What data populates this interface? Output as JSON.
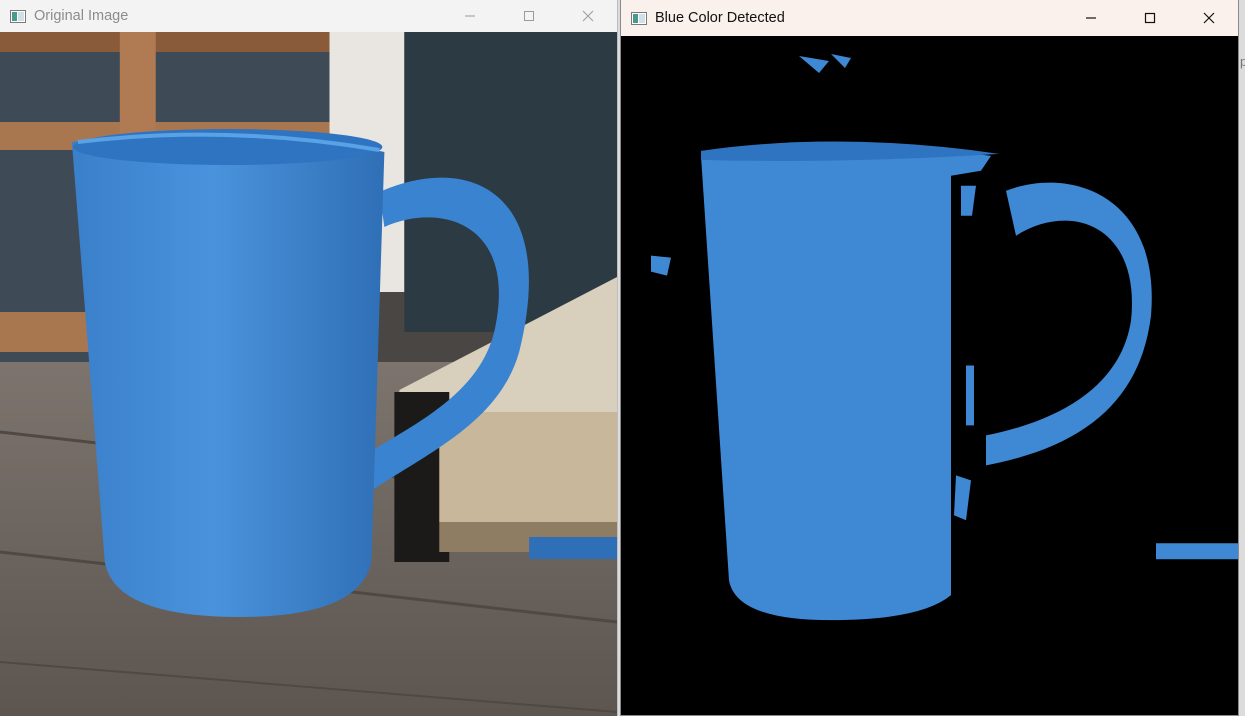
{
  "windows": {
    "original": {
      "title": "Original Image",
      "icon": "app-window-icon"
    },
    "detected": {
      "title": "Blue Color Detected",
      "icon": "app-window-icon"
    }
  },
  "controls": [
    "minimize-icon",
    "maximize-icon",
    "close-icon"
  ],
  "colors": {
    "mug_blue": "#3f88d4",
    "mug_blue_dark": "#2f6fb6",
    "mask_background": "#000000",
    "wood": "#6e6660",
    "book_pages": "#d9cfbd",
    "book_cover": "#1c1a18",
    "shelf": "#9b6a45",
    "wall": "#e9e6e2"
  },
  "edge_glyph": "p"
}
